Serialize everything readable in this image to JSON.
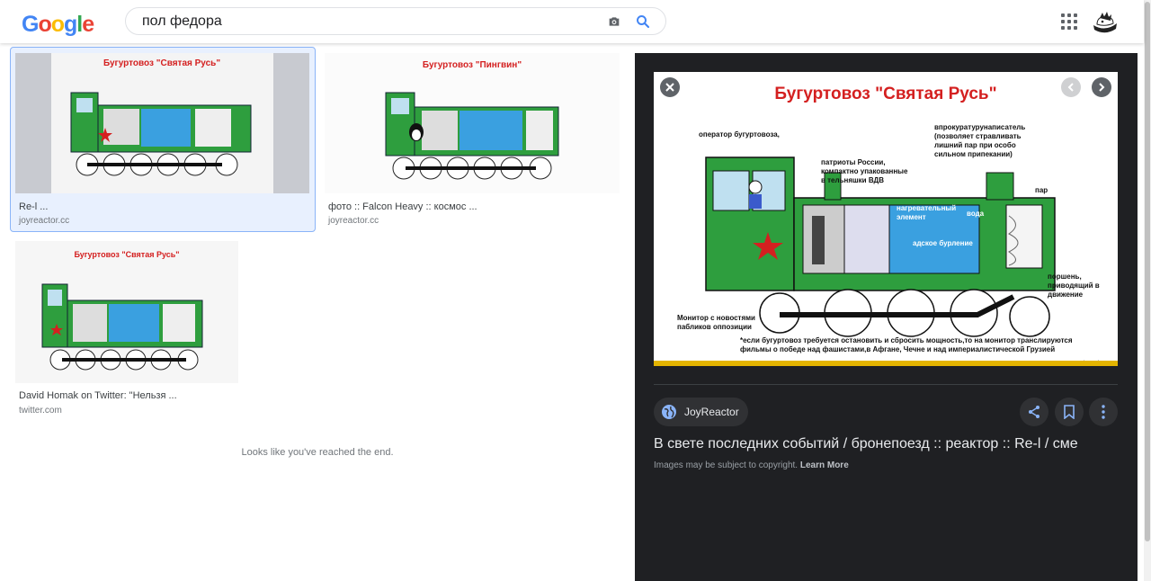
{
  "header": {
    "logo": [
      "G",
      "o",
      "o",
      "g",
      "l",
      "e"
    ],
    "search_value": "пол федора"
  },
  "results": [
    {
      "title": "Re-l ...",
      "source": "joyreactor.cc",
      "image": {
        "heading": "Бугуртовоз \"Святая Русь\""
      }
    },
    {
      "title": "фото :: Falcon Heavy :: космос ...",
      "source": "joyreactor.cc",
      "image": {
        "heading": "Бугуртовоз \"Пингвин\""
      }
    },
    {
      "title": "David Homak on Twitter: \"Нельзя ...",
      "source": "twitter.com",
      "image": {
        "heading": "Бугуртовоз \"Святая Русь\""
      }
    }
  ],
  "end_message": "Looks like you've reached the end.",
  "preview": {
    "image": {
      "heading": "Бугуртовоз \"Святая Русь\"",
      "labels": {
        "operator": "оператор бугуртовоза,",
        "patriots": "патриоты России, компактно упакованные в тельняшки ВДВ",
        "writer": "впрокуратурунаписатель (позволяет стравливать лишний пар при особо сильном припекании)",
        "steam": "пар",
        "magnet": "нагревательный элемент",
        "water": "вода",
        "boiling": "адское бурление",
        "piston": "поршень, приводящий в движение",
        "monitor": "Монитор с новостями пабликов оппозиции",
        "footnote1": "*если бугуртовоз требуется остановить и сбросить мощность,то на монитор транслируются",
        "footnote2": "фильмы о победе над фашистами,в Афгане, Чечне и над империалистической Грузией",
        "watermark": "joyreactor.cc"
      }
    },
    "source_label": "JoyReactor",
    "title": "В свете последних событий / бронепоезд :: реактор :: Re-l / сме",
    "copyright_note": "Images may be subject to copyright.",
    "learn_more": "Learn More"
  },
  "colors": {
    "panel_bg": "#1f2023",
    "train_green": "#2e9e3e",
    "heading_red": "#d42020",
    "selected_bg": "#e8f0fe"
  }
}
